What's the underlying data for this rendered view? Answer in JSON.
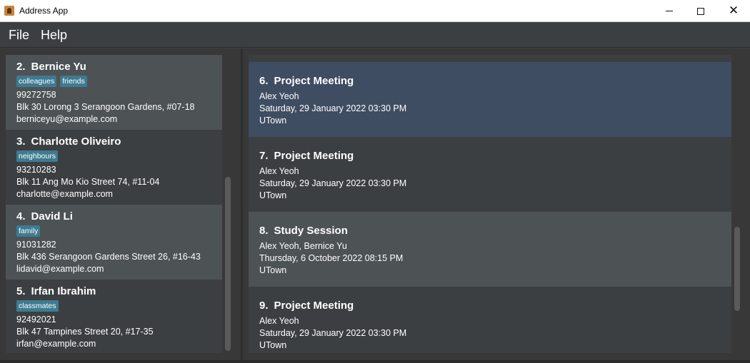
{
  "window": {
    "title": "Address App"
  },
  "menu": {
    "file": "File",
    "help": "Help"
  },
  "persons": [
    {
      "index": "2.",
      "name": "Bernice Yu",
      "tags": [
        "colleagues",
        "friends"
      ],
      "phone": "99272758",
      "address": "Blk 30 Lorong 3 Serangoon Gardens, #07-18",
      "email": "berniceyu@example.com"
    },
    {
      "index": "3.",
      "name": "Charlotte Oliveiro",
      "tags": [
        "neighbours"
      ],
      "phone": "93210283",
      "address": "Blk 11 Ang Mo Kio Street 74, #11-04",
      "email": "charlotte@example.com"
    },
    {
      "index": "4.",
      "name": "David Li",
      "tags": [
        "family"
      ],
      "phone": "91031282",
      "address": "Blk 436 Serangoon Gardens Street 26, #16-43",
      "email": "lidavid@example.com"
    },
    {
      "index": "5.",
      "name": "Irfan Ibrahim",
      "tags": [
        "classmates"
      ],
      "phone": "92492021",
      "address": "Blk 47 Tampines Street 20, #17-35",
      "email": "irfan@example.com"
    }
  ],
  "events": [
    {
      "index": "6.",
      "title": "Project Meeting",
      "people": "Alex Yeoh",
      "datetime": "Saturday, 29 January 2022 03:30 PM",
      "location": "UTown"
    },
    {
      "index": "7.",
      "title": "Project Meeting",
      "people": "Alex Yeoh",
      "datetime": "Saturday, 29 January 2022 03:30 PM",
      "location": "UTown"
    },
    {
      "index": "8.",
      "title": "Study Session",
      "people": "Alex Yeoh, Bernice Yu",
      "datetime": "Thursday, 6 October 2022 08:15 PM",
      "location": "UTown"
    },
    {
      "index": "9.",
      "title": "Project Meeting",
      "people": "Alex Yeoh",
      "datetime": "Saturday, 29 January 2022 03:30 PM",
      "location": "UTown"
    }
  ],
  "colors": {
    "tag": "#3e7b91",
    "selected": "#3f4d62",
    "alt_row": "#4d5254",
    "background": "#3c3f41"
  }
}
